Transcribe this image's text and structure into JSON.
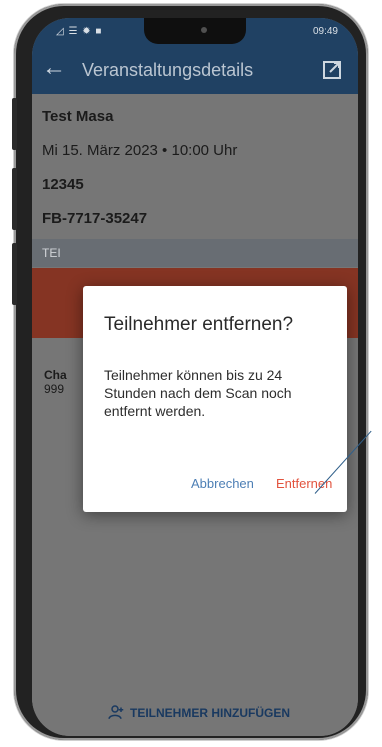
{
  "status_bar": {
    "left": "◿ ☰ ✹ ■",
    "time": "09:49"
  },
  "header": {
    "title": "Veranstaltungsdetails"
  },
  "event": {
    "name": "Test Masa",
    "date_time": "Mi 15. März 2023 • 10:00 Uhr",
    "code": "12345",
    "reference": "FB-7717-35247"
  },
  "section": {
    "label": "TEI"
  },
  "participant": {
    "name": "Cha",
    "id": "999"
  },
  "dialog": {
    "title": "Teilnehmer entfernen?",
    "message": "Teilnehmer können bis zu 24 Stunden nach dem Scan noch entfernt werden.",
    "cancel": "Abbrechen",
    "confirm": "Entfernen"
  },
  "footer": {
    "add_button": "TEILNEHMER HINZUFÜGEN"
  },
  "colors": {
    "header": "#23466a",
    "accent_blue": "#4d7fb5",
    "accent_red": "#e2533e"
  }
}
